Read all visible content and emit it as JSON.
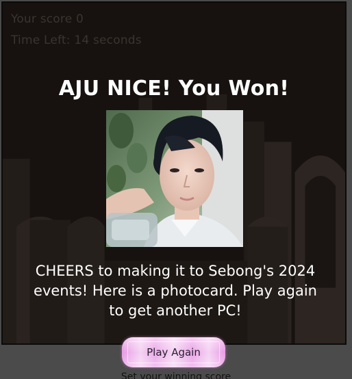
{
  "hud": {
    "score_text": "Your score 0",
    "time_text": "Time Left: 14 seconds"
  },
  "win": {
    "title": "AJU NICE! You Won!",
    "message": "CHEERS to making it to Sebong's 2024 events! Here is a photocard. Play again to get another PC!",
    "photocard_icon": "photocard-portrait-image"
  },
  "controls": {
    "play_again_label": "Play Again",
    "set_score_label": "Set your winning score"
  },
  "colors": {
    "overlay_bg": "#17120f",
    "title_text": "#ffffff",
    "button_pink": "#e69be3"
  }
}
